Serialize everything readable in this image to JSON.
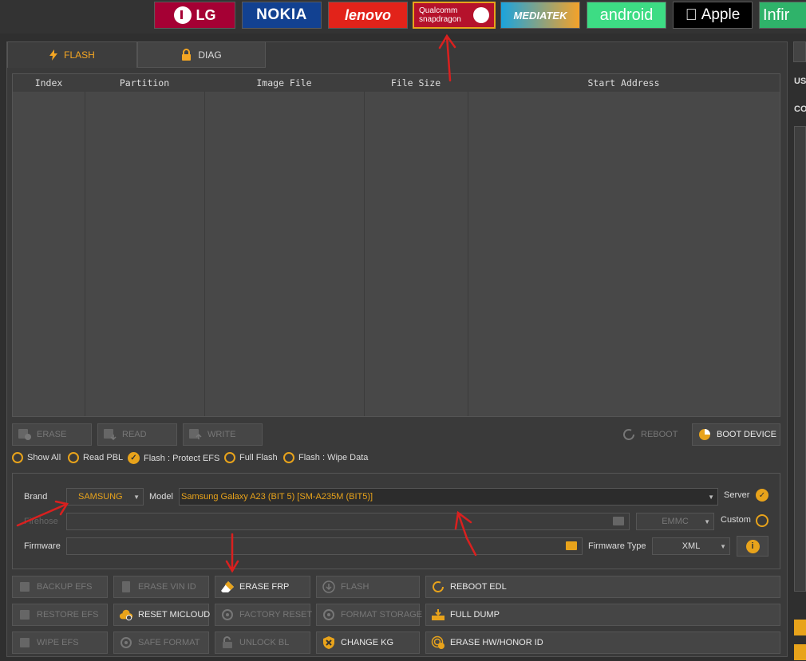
{
  "brands": [
    {
      "label": "LG",
      "bg": "#a50034",
      "selected": false
    },
    {
      "label": "NOKIA",
      "bg": "#124191",
      "selected": false
    },
    {
      "label": "lenovo",
      "bg": "#e2231a",
      "selected": false
    },
    {
      "label": "Qualcomm snapdragon",
      "bg": "#b5122b",
      "selected": true
    },
    {
      "label": "MEDIATEK",
      "bg": "#f3a22a",
      "selected": false
    },
    {
      "label": "android",
      "bg": "#3ddc84",
      "selected": false
    },
    {
      "label": "Apple",
      "bg": "#000000",
      "selected": false
    },
    {
      "label": "Infir",
      "bg": "#2fb36a",
      "selected": false
    }
  ],
  "tabs": {
    "flash": "FLASH",
    "diag": "DIAG"
  },
  "table": {
    "columns": [
      "Index",
      "Partition",
      "Image File",
      "File Size",
      "Start Address"
    ]
  },
  "actions": {
    "erase": "ERASE",
    "read": "READ",
    "write": "WRITE",
    "reboot": "REBOOT",
    "boot_device": "BOOT DEVICE"
  },
  "options": {
    "show_all": "Show All",
    "read_pbl": "Read PBL",
    "protect_efs": "Flash : Protect EFS",
    "full_flash": "Full Flash",
    "wipe_data": "Flash : Wipe Data"
  },
  "form": {
    "brand_label": "Brand",
    "brand_value": "SAMSUNG",
    "model_label": "Model",
    "model_value": "Samsung Galaxy A23 (BIT 5) [SM-A235M (BIT5)]",
    "server_label": "Server",
    "firehose_label": "Firehose",
    "storage_value": "EMMC",
    "custom_label": "Custom",
    "firmware_label": "Firmware",
    "firmware_type_label": "Firmware Type",
    "firmware_type_value": "XML"
  },
  "tools": {
    "backup_efs": "BACKUP EFS",
    "erase_vin_id": "ERASE VIN ID",
    "erase_frp": "ERASE FRP",
    "flash": "FLASH",
    "reboot_edl": "REBOOT EDL",
    "restore_efs": "RESTORE EFS",
    "reset_micloud": "RESET MICLOUD",
    "factory_reset": "FACTORY RESET",
    "format_storage": "FORMAT STORAGE",
    "full_dump": "FULL DUMP",
    "wipe_efs": "WIPE EFS",
    "safe_format": "SAFE FORMAT",
    "unlock_bl": "UNLOCK BL",
    "change_kg": "CHANGE KG",
    "erase_hw_honor_id": "ERASE HW/HONOR ID"
  },
  "sidebar": {
    "us": "US",
    "co": "CO"
  },
  "colors": {
    "accent": "#e8a31b",
    "annotation": "#d9201f"
  }
}
